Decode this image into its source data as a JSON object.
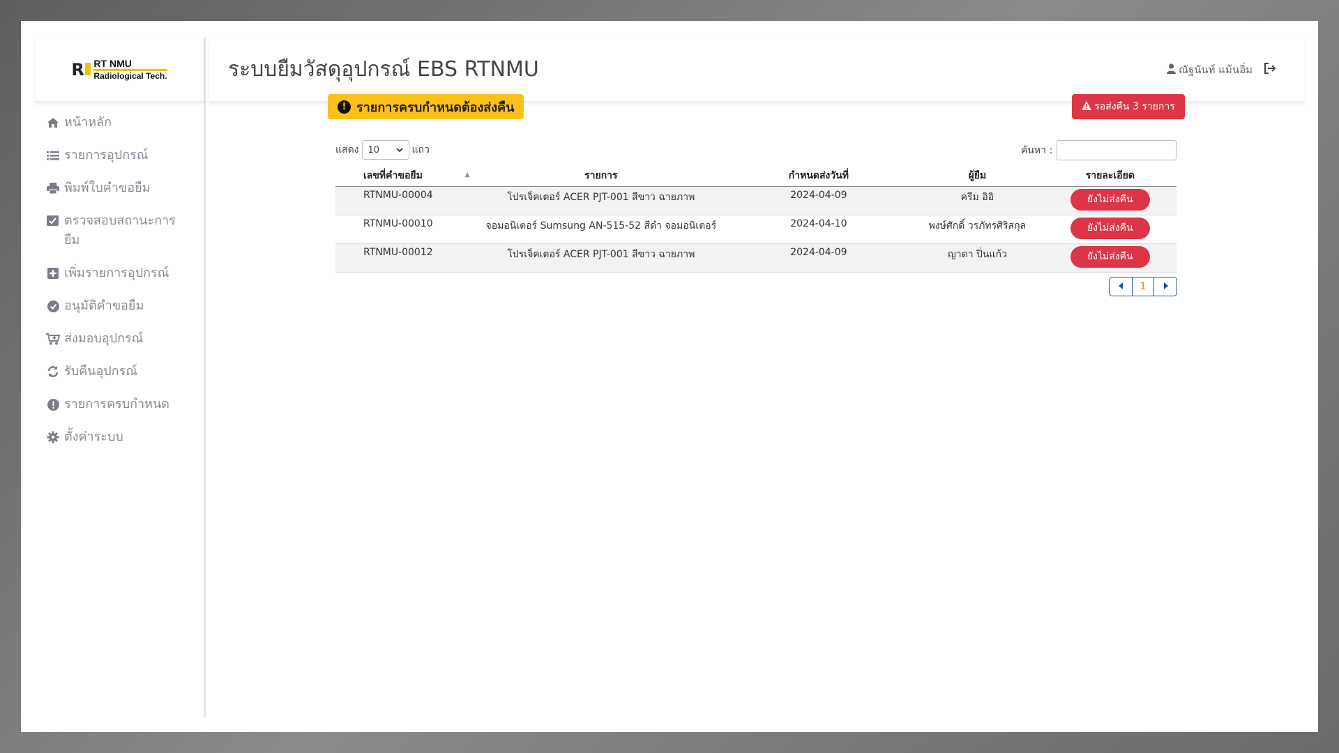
{
  "logo": {
    "line1": "RT NMU",
    "line2": "Radiological Tech."
  },
  "header": {
    "title": "ระบบยืมวัสดุอุปกรณ์ EBS RTNMU",
    "user_name": "ณัฐนันท์ แม้นอิ่ม"
  },
  "sidebar": {
    "items": [
      {
        "label": "หน้าหลัก",
        "icon": "home-icon"
      },
      {
        "label": "รายการอุปกรณ์",
        "icon": "list-icon"
      },
      {
        "label": "พิมพ์ใบคำขอยืม",
        "icon": "print-icon"
      },
      {
        "label": "ตรวจสอบสถานะการยืม",
        "icon": "check-square-icon"
      },
      {
        "label": "เพิ่มรายการอุปกรณ์",
        "icon": "plus-square-icon"
      },
      {
        "label": "อนุมัติคำขอยืม",
        "icon": "check-circle-icon"
      },
      {
        "label": "ส่งมอบอุปกรณ์",
        "icon": "cart-icon"
      },
      {
        "label": "รับคืนอุปกรณ์",
        "icon": "sync-icon"
      },
      {
        "label": "รายการครบกำหนด",
        "icon": "exclamation-circle-icon"
      },
      {
        "label": "ตั้งค่าระบบ",
        "icon": "gear-icon"
      }
    ]
  },
  "content": {
    "alert_label": "รายการครบกำหนดต้องส่งคืน",
    "pending_label": "รอส่งคืน 3 รายการ",
    "show_label": "แสดง",
    "rows_label": "แถว",
    "page_size": "10",
    "search_label": "ค้นหา :",
    "search_value": "",
    "columns": [
      "เลขที่คำขอยืม",
      "รายการ",
      "กำหนดส่งวันที่",
      "ผู้ยืม",
      "รายละเอียด"
    ],
    "rows": [
      {
        "id": "RTNMU-00004",
        "item": "โปรเจ็คเตอร์ ACER PJT-001 สีขาว ฉายภาพ",
        "due": "2024-04-09",
        "borrower": "ครีม อิอิ",
        "status": "ยังไม่ส่งคืน"
      },
      {
        "id": "RTNMU-00010",
        "item": "จอมอนิเตอร์ Sumsung AN-515-52 สีดำ จอมอนิเตอร์",
        "due": "2024-04-10",
        "borrower": "พงษ์ศักดิ์ วรภัทรศิริสกุล",
        "status": "ยังไม่ส่งคืน"
      },
      {
        "id": "RTNMU-00012",
        "item": "โปรเจ็คเตอร์ ACER PJT-001 สีขาว ฉายภาพ",
        "due": "2024-04-09",
        "borrower": "ญาดา ปิ่นแก้ว",
        "status": "ยังไม่ส่งคืน"
      }
    ],
    "current_page": "1"
  }
}
